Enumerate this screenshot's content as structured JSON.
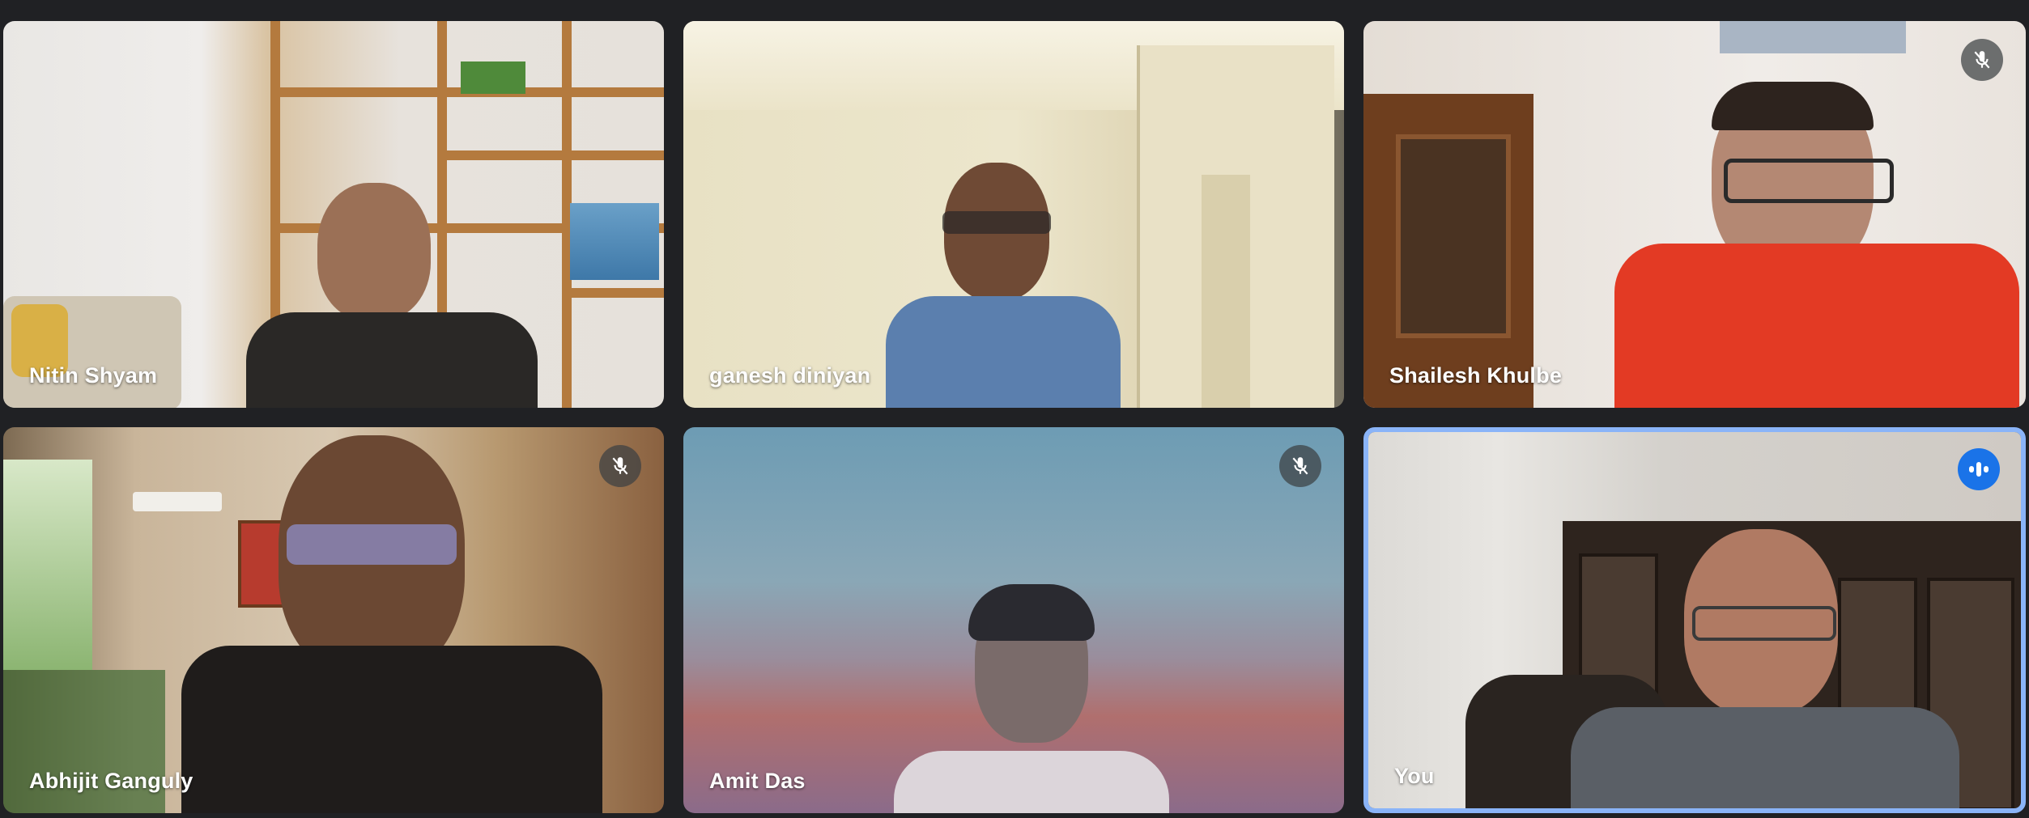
{
  "participants": [
    {
      "name": "Nitin Shyam",
      "muted": false,
      "speaking": false
    },
    {
      "name": "ganesh diniyan",
      "muted": false,
      "speaking": false
    },
    {
      "name": "Shailesh Khulbe",
      "muted": true,
      "speaking": false
    },
    {
      "name": "Abhijit Ganguly",
      "muted": true,
      "speaking": false
    },
    {
      "name": "Amit Das",
      "muted": true,
      "speaking": false
    },
    {
      "name": "You",
      "muted": false,
      "speaking": true
    }
  ],
  "icons": {
    "muted": "mic-off-icon",
    "speaking": "audio-level-icon"
  },
  "colors": {
    "background": "#202124",
    "active_speaker_border": "#8ab4f8",
    "speaking_badge": "#1a73e8"
  }
}
